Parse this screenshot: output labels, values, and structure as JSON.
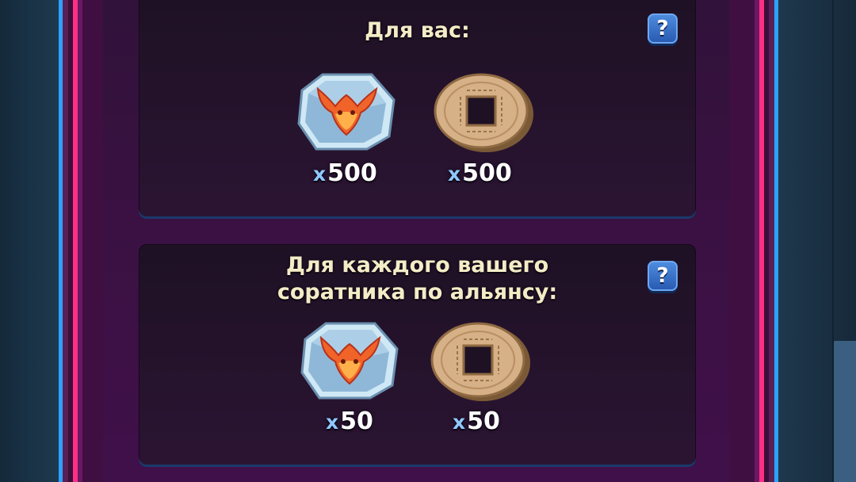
{
  "sections": {
    "personal": {
      "title": "Для вас:",
      "rewards": [
        {
          "icon": "bull-emblem-crystal-icon",
          "prefix": "x",
          "amount": "500"
        },
        {
          "icon": "bronze-coin-icon",
          "prefix": "x",
          "amount": "500"
        }
      ]
    },
    "alliance": {
      "title_line1": "Для каждого вашего",
      "title_line2": "соратника по альянсу:",
      "rewards": [
        {
          "icon": "bull-emblem-crystal-icon",
          "prefix": "x",
          "amount": "50"
        },
        {
          "icon": "bronze-coin-icon",
          "prefix": "x",
          "amount": "50"
        }
      ]
    }
  },
  "help_button": {
    "label": "?"
  },
  "colors": {
    "frame_pink": "#ff2f86",
    "frame_blue": "#2aa3ff",
    "panel_bg": "#1e1124",
    "title_text": "#f4ecc6",
    "quantity_prefix": "#8fc8ff"
  }
}
